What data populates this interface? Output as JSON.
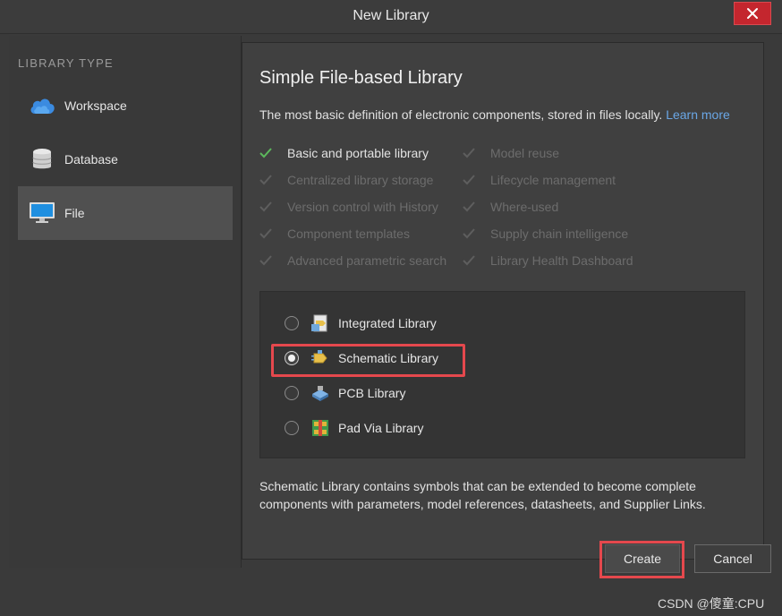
{
  "window": {
    "title": "New Library",
    "close_icon": "close-icon"
  },
  "sidebar": {
    "heading": "LIBRARY TYPE",
    "items": [
      {
        "label": "Workspace",
        "icon": "cloud-icon",
        "active": false
      },
      {
        "label": "Database",
        "icon": "database-icon",
        "active": false
      },
      {
        "label": "File",
        "icon": "monitor-icon",
        "active": true
      }
    ]
  },
  "main": {
    "title": "Simple File-based Library",
    "description": "The most basic definition of electronic components, stored in files locally.",
    "learn_more": "Learn more",
    "features_left": [
      {
        "label": "Basic and portable library",
        "enabled": true
      },
      {
        "label": "Centralized library storage",
        "enabled": false
      },
      {
        "label": "Version control with History",
        "enabled": false
      },
      {
        "label": "Component templates",
        "enabled": false
      },
      {
        "label": "Advanced parametric search",
        "enabled": false
      }
    ],
    "features_right": [
      {
        "label": "Model reuse",
        "enabled": false
      },
      {
        "label": "Lifecycle management",
        "enabled": false
      },
      {
        "label": "Where-used",
        "enabled": false
      },
      {
        "label": "Supply chain intelligence",
        "enabled": false
      },
      {
        "label": "Library Health Dashboard",
        "enabled": false
      }
    ],
    "options": [
      {
        "label": "Integrated Library",
        "selected": false,
        "icon": "integrated-library-icon"
      },
      {
        "label": "Schematic Library",
        "selected": true,
        "icon": "schematic-library-icon"
      },
      {
        "label": "PCB Library",
        "selected": false,
        "icon": "pcb-library-icon"
      },
      {
        "label": "Pad Via Library",
        "selected": false,
        "icon": "pad-via-library-icon"
      }
    ],
    "option_description": "Schematic Library contains symbols that can be extended to become complete components with parameters, model references, datasheets, and Supplier Links."
  },
  "footer": {
    "create_label": "Create",
    "cancel_label": "Cancel"
  },
  "watermark": "CSDN @傻童:CPU",
  "colors": {
    "accent_link": "#6aa7e6",
    "highlight": "#e5484d",
    "close_red": "#c4262e",
    "check_green": "#5cb85c"
  }
}
